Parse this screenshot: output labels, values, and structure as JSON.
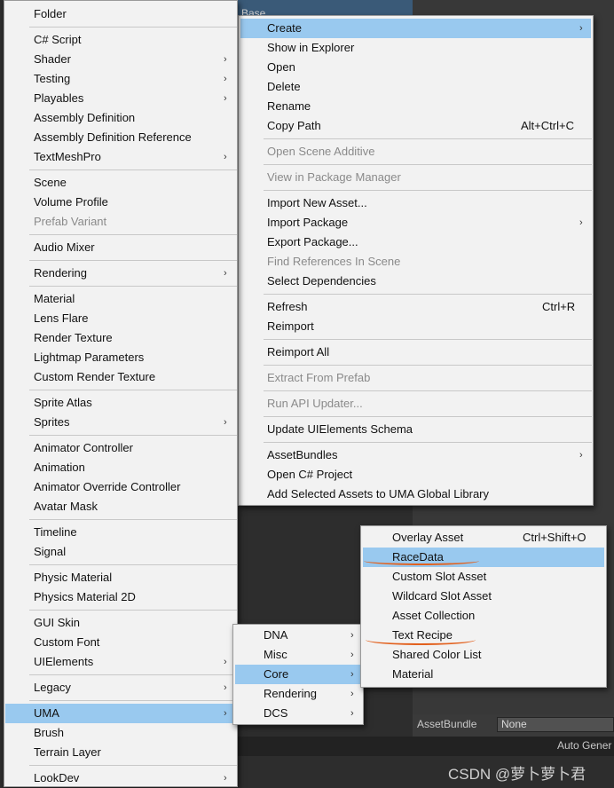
{
  "background": {
    "top_fragment": "...Base",
    "asset_bundle_label": "AssetBundle",
    "asset_bundle_value": "None",
    "auto_generate": "Auto Gener",
    "watermark": "CSDN @萝卜萝卜君"
  },
  "context_menu": {
    "items": [
      {
        "label": "Create",
        "arrow": "›"
      },
      {
        "label": "Show in Explorer"
      },
      {
        "label": "Open"
      },
      {
        "label": "Delete"
      },
      {
        "label": "Rename"
      },
      {
        "label": "Copy Path",
        "shortcut": "Alt+Ctrl+C"
      },
      {
        "label": "Open Scene Additive"
      },
      {
        "label": "View in Package Manager"
      },
      {
        "label": "Import New Asset..."
      },
      {
        "label": "Import Package",
        "arrow": "›"
      },
      {
        "label": "Export Package..."
      },
      {
        "label": "Find References In Scene"
      },
      {
        "label": "Select Dependencies"
      },
      {
        "label": "Refresh",
        "shortcut": "Ctrl+R"
      },
      {
        "label": "Reimport"
      },
      {
        "label": "Reimport All"
      },
      {
        "label": "Extract From Prefab"
      },
      {
        "label": "Run API Updater..."
      },
      {
        "label": "Update UIElements Schema"
      },
      {
        "label": "AssetBundles",
        "arrow": "›"
      },
      {
        "label": "Open C# Project"
      },
      {
        "label": "Add Selected Assets to UMA Global Library"
      }
    ]
  },
  "create_menu": {
    "items": [
      {
        "label": "Folder"
      },
      {
        "label": "C# Script"
      },
      {
        "label": "Shader",
        "arrow": "›"
      },
      {
        "label": "Testing",
        "arrow": "›"
      },
      {
        "label": "Playables",
        "arrow": "›"
      },
      {
        "label": "Assembly Definition"
      },
      {
        "label": "Assembly Definition Reference"
      },
      {
        "label": "TextMeshPro",
        "arrow": "›"
      },
      {
        "label": "Scene"
      },
      {
        "label": "Volume Profile"
      },
      {
        "label": "Prefab Variant"
      },
      {
        "label": "Audio Mixer"
      },
      {
        "label": "Rendering",
        "arrow": "›"
      },
      {
        "label": "Material"
      },
      {
        "label": "Lens Flare"
      },
      {
        "label": "Render Texture"
      },
      {
        "label": "Lightmap Parameters"
      },
      {
        "label": "Custom Render Texture"
      },
      {
        "label": "Sprite Atlas"
      },
      {
        "label": "Sprites",
        "arrow": "›"
      },
      {
        "label": "Animator Controller"
      },
      {
        "label": "Animation"
      },
      {
        "label": "Animator Override Controller"
      },
      {
        "label": "Avatar Mask"
      },
      {
        "label": "Timeline"
      },
      {
        "label": "Signal"
      },
      {
        "label": "Physic Material"
      },
      {
        "label": "Physics Material 2D"
      },
      {
        "label": "GUI Skin"
      },
      {
        "label": "Custom Font"
      },
      {
        "label": "UIElements",
        "arrow": "›"
      },
      {
        "label": "Legacy",
        "arrow": "›"
      },
      {
        "label": "UMA",
        "arrow": "›"
      },
      {
        "label": "Brush"
      },
      {
        "label": "Terrain Layer"
      },
      {
        "label": "LookDev",
        "arrow": "›"
      }
    ]
  },
  "uma_menu": {
    "items": [
      {
        "label": "DNA",
        "arrow": "›"
      },
      {
        "label": "Misc",
        "arrow": "›"
      },
      {
        "label": "Core",
        "arrow": "›"
      },
      {
        "label": "Rendering",
        "arrow": "›"
      },
      {
        "label": "DCS",
        "arrow": "›"
      }
    ]
  },
  "core_menu": {
    "items": [
      {
        "label": "Overlay Asset",
        "shortcut": "Ctrl+Shift+O"
      },
      {
        "label": "RaceData"
      },
      {
        "label": "Custom Slot Asset"
      },
      {
        "label": "Wildcard Slot Asset"
      },
      {
        "label": "Asset Collection"
      },
      {
        "label": "Text Recipe"
      },
      {
        "label": "Shared Color List"
      },
      {
        "label": "Material"
      }
    ]
  }
}
